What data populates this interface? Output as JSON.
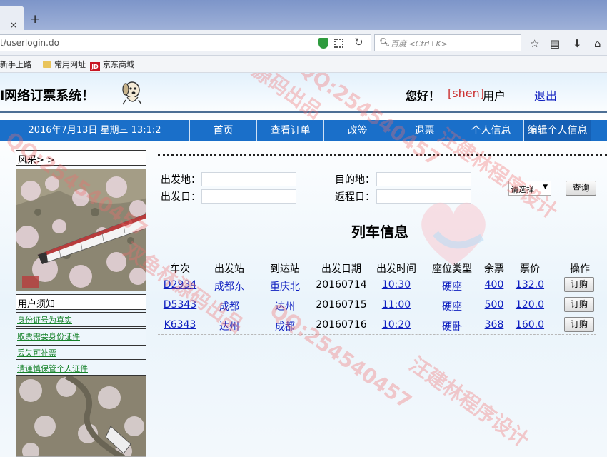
{
  "browser": {
    "tab_close": "×",
    "new_tab": "+",
    "url": "t/userlogin.do",
    "search_placeholder": "百度 <Ctrl+K>",
    "bookmarks": [
      {
        "label": "新手上路",
        "icon": "firefox-icon"
      },
      {
        "label": "常用网址",
        "icon": "folder-icon"
      },
      {
        "label": "京东商城",
        "icon": "jd-icon",
        "icon_text": "JD"
      }
    ]
  },
  "header": {
    "site_title": "l网络订票系统！",
    "greeting": "您好！",
    "username": "[shen]",
    "user_suffix": "用户",
    "logout": "退出"
  },
  "menu": {
    "date": "2016年7月13日 星期三 13:1:2",
    "items": [
      "首页",
      "查看订单",
      "改签",
      "退票",
      "个人信息",
      "编辑个人信息"
    ]
  },
  "sidebar": {
    "style_title": "风采> >",
    "notice_title": "用户须知",
    "notices": [
      "身份证号为真实",
      "取票需要身份证件",
      "丢失可补票",
      "请谨慎保管个人证件"
    ]
  },
  "search": {
    "from_label": "出发地：",
    "to_label": "目的地：",
    "depart_label": "出发日：",
    "return_label": "返程日：",
    "select_value": "请选择",
    "query_button": "查询"
  },
  "trains": {
    "title": "列车信息",
    "headers": [
      "车次",
      "出发站",
      "到达站",
      "出发日期",
      "出发时间",
      "座位类型",
      "余票",
      "票价",
      "操作"
    ],
    "rows": [
      [
        "D2934",
        "成都东",
        "重庆北",
        "20160714",
        "10:30",
        "硬座",
        "400",
        "132.0",
        "订购"
      ],
      [
        "D5343",
        "成都",
        "达州",
        "20160715",
        "11:00",
        "硬座",
        "500",
        "120.0",
        "订购"
      ],
      [
        "K6343",
        "达州",
        "成都",
        "20160716",
        "10:20",
        "硬卧",
        "368",
        "160.0",
        "订购"
      ]
    ]
  },
  "watermarks": [
    "双鱼林源码出品",
    "QQ:254540457",
    "汪建林程序设计"
  ],
  "colors": {
    "menu_bar": "#1a6fc9",
    "link": "#1020c0",
    "notice_link": "#16822a",
    "username": "#cc3333"
  }
}
